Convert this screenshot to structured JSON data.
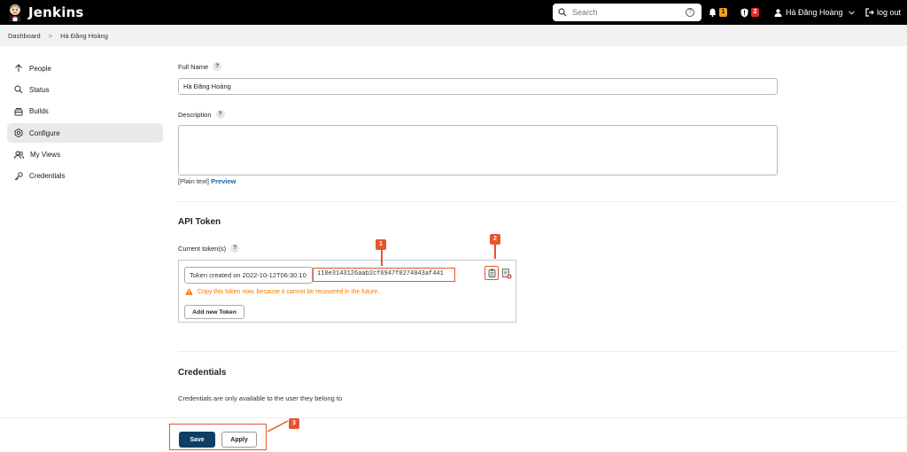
{
  "header": {
    "app_name": "Jenkins",
    "search_placeholder": "Search",
    "search_help": "?",
    "notifications_count": "1",
    "security_count": "2",
    "user_name": "Hà Đăng Hoàng",
    "logout_label": "log out",
    "notification_badge_color": "#f0a020",
    "security_badge_color": "#e02a2a"
  },
  "breadcrumb": {
    "items": [
      "Dashboard",
      "Hà Đăng Hoàng"
    ],
    "separator": ">"
  },
  "sidebar": {
    "items": [
      {
        "label": "People",
        "icon": "arrow-up-icon"
      },
      {
        "label": "Status",
        "icon": "search-icon"
      },
      {
        "label": "Builds",
        "icon": "builds-icon"
      },
      {
        "label": "Configure",
        "icon": "gear-icon",
        "active": true
      },
      {
        "label": "My Views",
        "icon": "people-icon"
      },
      {
        "label": "Credentials",
        "icon": "key-icon"
      }
    ]
  },
  "form": {
    "full_name_label": "Full Name",
    "full_name_value": "Hà Đăng Hoàng",
    "description_label": "Description",
    "plain_text": "[Plain text]",
    "preview_link": "Preview",
    "help": "?"
  },
  "api_token": {
    "title": "API Token",
    "current_tokens_label": "Current token(s)",
    "token_name": "Token created on 2022-10-12T06:30:10",
    "token_value": "110e3143126aab2cf6947f0274043af441",
    "warning": "Copy this token now, because it cannot be recovered in the future.",
    "add_button": "Add new Token"
  },
  "credentials": {
    "title": "Credentials",
    "note": "Credentials are only available to the user they belong to"
  },
  "actions": {
    "save": "Save",
    "apply": "Apply"
  },
  "callouts": [
    "1",
    "2",
    "3"
  ],
  "colors": {
    "header_bg": "#000000",
    "accent_annotation": "#e8532f",
    "save_button": "#0f3d63",
    "link": "#1f5fb0",
    "warning": "#f07a00"
  }
}
